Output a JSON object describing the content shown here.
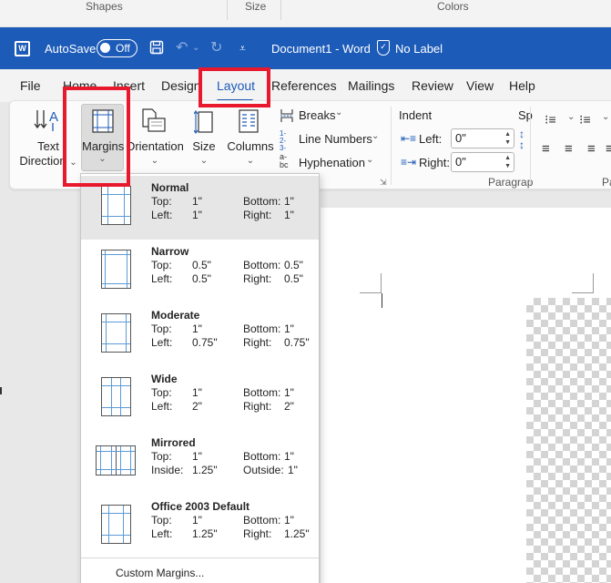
{
  "top_strip": {
    "shapes": "Shapes",
    "size": "Size",
    "colors": "Colors"
  },
  "titlebar": {
    "autosave": "AutoSave",
    "toggle": "Off",
    "doc_title": "Document1  -  Word",
    "label": "No Label",
    "bg_color": "#1d5bb9"
  },
  "tabs": [
    "File",
    "Home",
    "Insert",
    "Design",
    "Layout",
    "References",
    "Mailings",
    "Review",
    "View",
    "Help"
  ],
  "active_tab": "Layout",
  "ribbon": {
    "text_direction": [
      "Text",
      "Direction"
    ],
    "margins": "Margins",
    "orientation": "Orientation",
    "size": "Size",
    "columns": "Columns",
    "breaks": "Breaks",
    "line_numbers": "Line Numbers",
    "hyphenation": "Hyphenation",
    "indent_title": "Indent",
    "indent_left_label": "Left:",
    "indent_left_value": "0\"",
    "indent_right_label": "Right:",
    "indent_right_value": "0\"",
    "spacing_partial": "Sp",
    "paragraph_partial": "Paragrap",
    "pa_partial": "Pa"
  },
  "margins_menu": {
    "options": [
      {
        "name": "Normal",
        "top_label": "Top:",
        "top": "1\"",
        "bottom_label": "Bottom:",
        "bottom": "1\"",
        "left_label": "Left:",
        "left": "1\"",
        "right_label": "Right:",
        "right": "1\""
      },
      {
        "name": "Narrow",
        "top_label": "Top:",
        "top": "0.5\"",
        "bottom_label": "Bottom:",
        "bottom": "0.5\"",
        "left_label": "Left:",
        "left": "0.5\"",
        "right_label": "Right:",
        "right": "0.5\""
      },
      {
        "name": "Moderate",
        "top_label": "Top:",
        "top": "1\"",
        "bottom_label": "Bottom:",
        "bottom": "1\"",
        "left_label": "Left:",
        "left": "0.75\"",
        "right_label": "Right:",
        "right": "0.75\""
      },
      {
        "name": "Wide",
        "top_label": "Top:",
        "top": "1\"",
        "bottom_label": "Bottom:",
        "bottom": "1\"",
        "left_label": "Left:",
        "left": "2\"",
        "right_label": "Right:",
        "right": "2\""
      },
      {
        "name": "Mirrored",
        "top_label": "Top:",
        "top": "1\"",
        "bottom_label": "Bottom:",
        "bottom": "1\"",
        "left_label": "Inside:",
        "left": "1.25\"",
        "right_label": "Outside:",
        "right": "1\""
      },
      {
        "name": "Office 2003 Default",
        "top_label": "Top:",
        "top": "1\"",
        "bottom_label": "Bottom:",
        "bottom": "1\"",
        "left_label": "Left:",
        "left": "1.25\"",
        "right_label": "Right:",
        "right": "1.25\""
      }
    ],
    "custom": "Custom Margins..."
  },
  "highlight_color": "#e8192c"
}
